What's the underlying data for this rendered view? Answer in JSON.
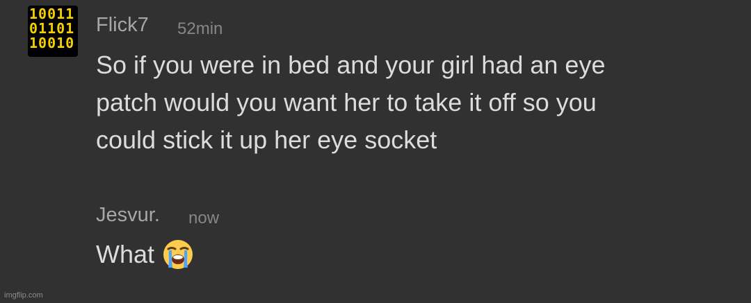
{
  "messages": [
    {
      "username": "Flick7",
      "timestamp": "52min",
      "avatar_text": "10011\n01101\n10010",
      "lines": [
        "So if you were in bed and your girl had an eye",
        "patch would you want her to take it off so you",
        "could stick it up her eye socket"
      ]
    },
    {
      "username": "Jesvur.",
      "timestamp": "now",
      "text": "What",
      "emoji": "loudly-crying-face-emoji"
    }
  ],
  "watermark": "imgflip.com",
  "colors": {
    "background": "#313131",
    "username": "#a7a7a7",
    "timestamp": "#878787",
    "message": "#dcdcdc",
    "avatar_accent": "#f4d000"
  }
}
